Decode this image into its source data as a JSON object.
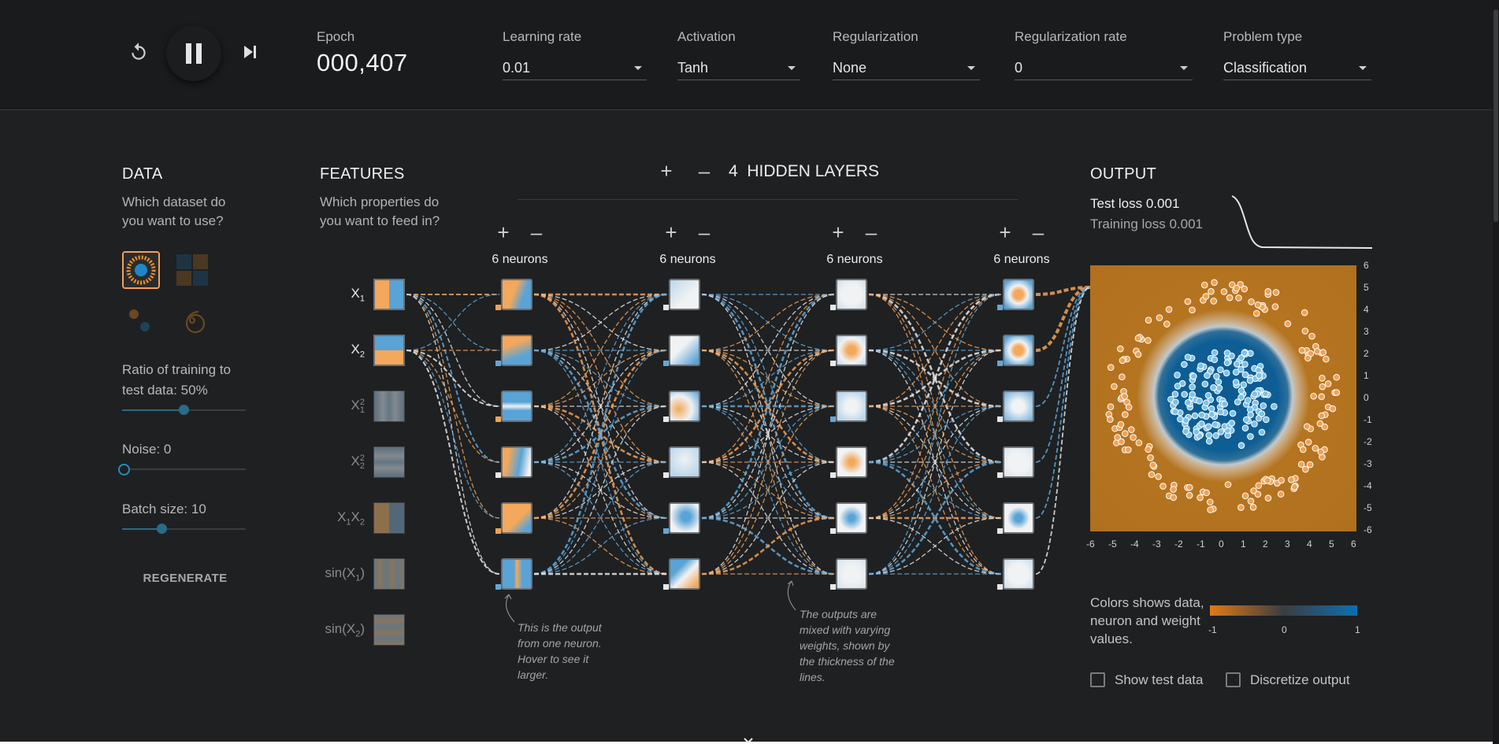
{
  "controls": {
    "reset_icon": "reset-icon",
    "play_pause_icon": "pause-icon",
    "step_icon": "step-forward-icon"
  },
  "top": {
    "epoch_label": "Epoch",
    "epoch_value": "000,407",
    "learning_rate_label": "Learning rate",
    "learning_rate_value": "0.01",
    "activation_label": "Activation",
    "activation_value": "Tanh",
    "regularization_label": "Regularization",
    "regularization_value": "None",
    "regularization_rate_label": "Regularization rate",
    "regularization_rate_value": "0",
    "problem_type_label": "Problem type",
    "problem_type_value": "Classification"
  },
  "data": {
    "title": "DATA",
    "subtitle": "Which dataset do you want to use?",
    "ratio_label": "Ratio of training to test data:  50%",
    "ratio_value": 50,
    "noise_label": "Noise:  0",
    "noise_value": 0,
    "batch_label": "Batch size:  10",
    "batch_value": 10,
    "regenerate": "REGENERATE"
  },
  "features": {
    "title": "FEATURES",
    "subtitle": "Which properties do you want to feed in?",
    "items": [
      {
        "base": "X",
        "sub": "1",
        "sup": "",
        "active": true
      },
      {
        "base": "X",
        "sub": "2",
        "sup": "",
        "active": true
      },
      {
        "base": "X",
        "sub": "1",
        "sup": "2",
        "active": false
      },
      {
        "base": "X",
        "sub": "2",
        "sup": "2",
        "active": false
      },
      {
        "base": "X",
        "sub": "1",
        "sup": "",
        "base2": "X",
        "sub2": "2",
        "active": false
      },
      {
        "base": "sin(X",
        "sub": "1",
        "sup": "",
        "tail": ")",
        "active": false
      },
      {
        "base": "sin(X",
        "sub": "2",
        "sup": "",
        "tail": ")",
        "active": false
      }
    ]
  },
  "network": {
    "plus": "+",
    "minus": "–",
    "hidden_layers_count": "4",
    "hidden_layers_label": "HIDDEN LAYERS",
    "layers": [
      {
        "neurons_label": "6 neurons"
      },
      {
        "neurons_label": "6 neurons"
      },
      {
        "neurons_label": "6 neurons"
      },
      {
        "neurons_label": "6 neurons"
      }
    ],
    "annotation_1": "This is the output from one neuron. Hover to see it larger.",
    "annotation_2": "The outputs are mixed with varying weights, shown by the thickness of the lines."
  },
  "output": {
    "title": "OUTPUT",
    "test_loss": "Test loss 0.001",
    "training_loss": "Training loss 0.001",
    "y_ticks": [
      "6",
      "5",
      "4",
      "3",
      "2",
      "1",
      "0",
      "-1",
      "-2",
      "-3",
      "-4",
      "-5",
      "-6"
    ],
    "x_ticks": [
      "-6",
      "-5",
      "-4",
      "-3",
      "-2",
      "-1",
      "0",
      "1",
      "2",
      "3",
      "4",
      "5",
      "6"
    ],
    "legend_text": "Colors shows data, neuron and weight values.",
    "legend_ticks": [
      "-1",
      "0",
      "1"
    ],
    "show_test_label": "Show test data",
    "discretize_label": "Discretize output"
  },
  "colors": {
    "orange": "#f59322",
    "blue": "#0877bd",
    "background": "#1f2022"
  }
}
